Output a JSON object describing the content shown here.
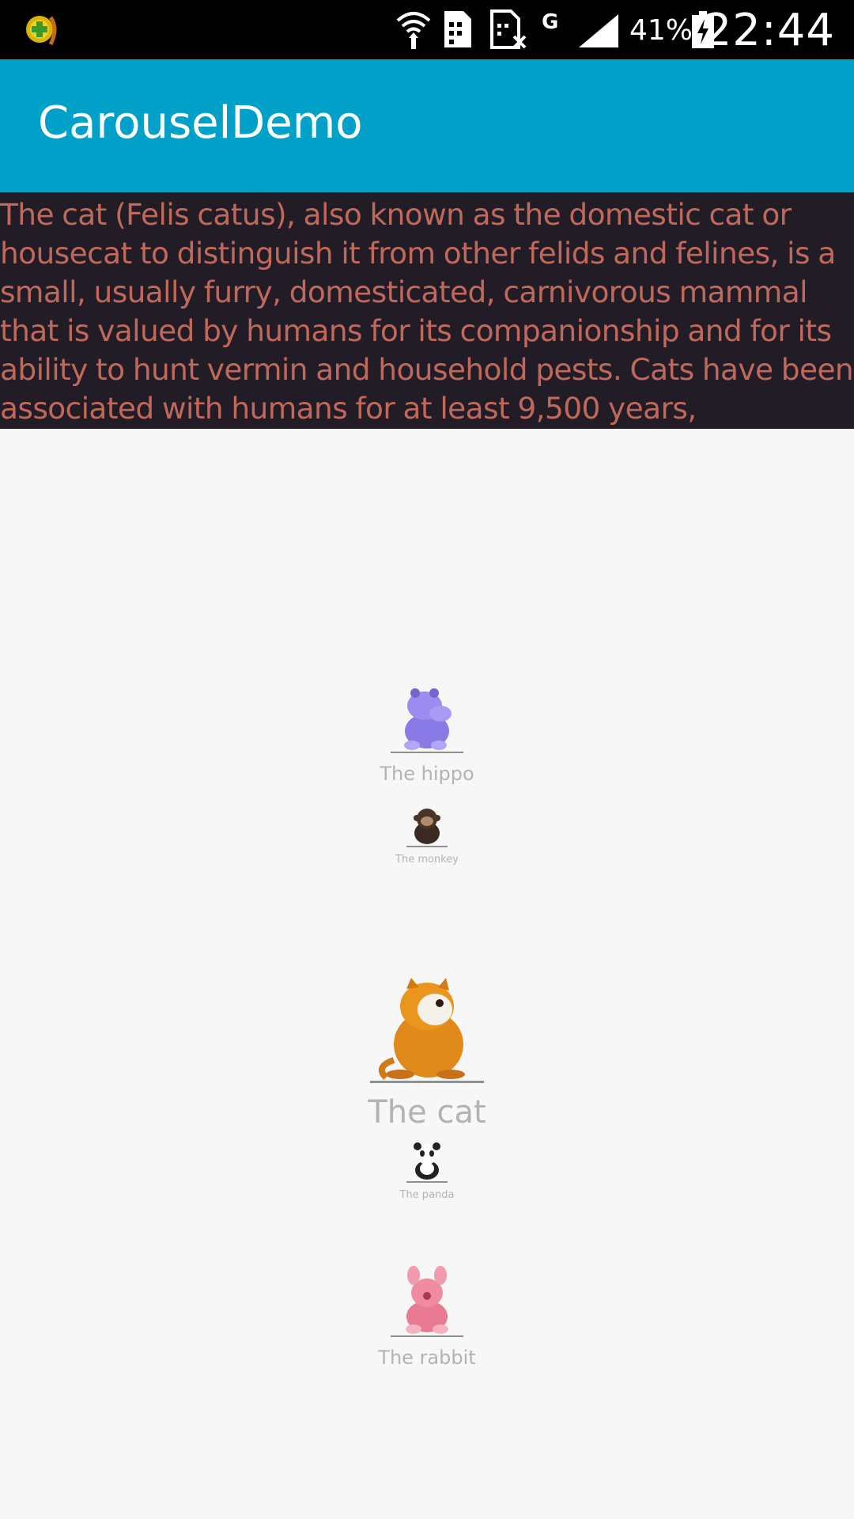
{
  "status_bar": {
    "battery_percent": "41%",
    "time": "22:44",
    "icons": [
      "app-notification-icon",
      "wifi-icon",
      "sim-card-icon",
      "no-sim-icon",
      "g-network-icon",
      "signal-icon",
      "battery-charging-icon"
    ]
  },
  "app_bar": {
    "title": "CarouselDemo"
  },
  "description": {
    "text": "The cat (Felis catus), also known as the domestic cat or housecat to distinguish it from other felids and felines, is a small, usually furry, domesticated, carnivorous mammal that is valued by humans for its companionship and for its ability to hunt vermin and household pests. Cats have been associated with humans for at least 9,500 years,"
  },
  "carousel": {
    "items": [
      {
        "label": "The hippo",
        "icon": "hippo-icon",
        "color": "#7c6cd8"
      },
      {
        "label": "The monkey",
        "icon": "monkey-icon",
        "color": "#3a2a22"
      },
      {
        "label": "The cat",
        "icon": "cat-icon",
        "color": "#e08a1c"
      },
      {
        "label": "The panda",
        "icon": "panda-icon",
        "color": "#222222"
      },
      {
        "label": "The rabbit",
        "icon": "rabbit-icon",
        "color": "#e87a92"
      }
    ]
  }
}
